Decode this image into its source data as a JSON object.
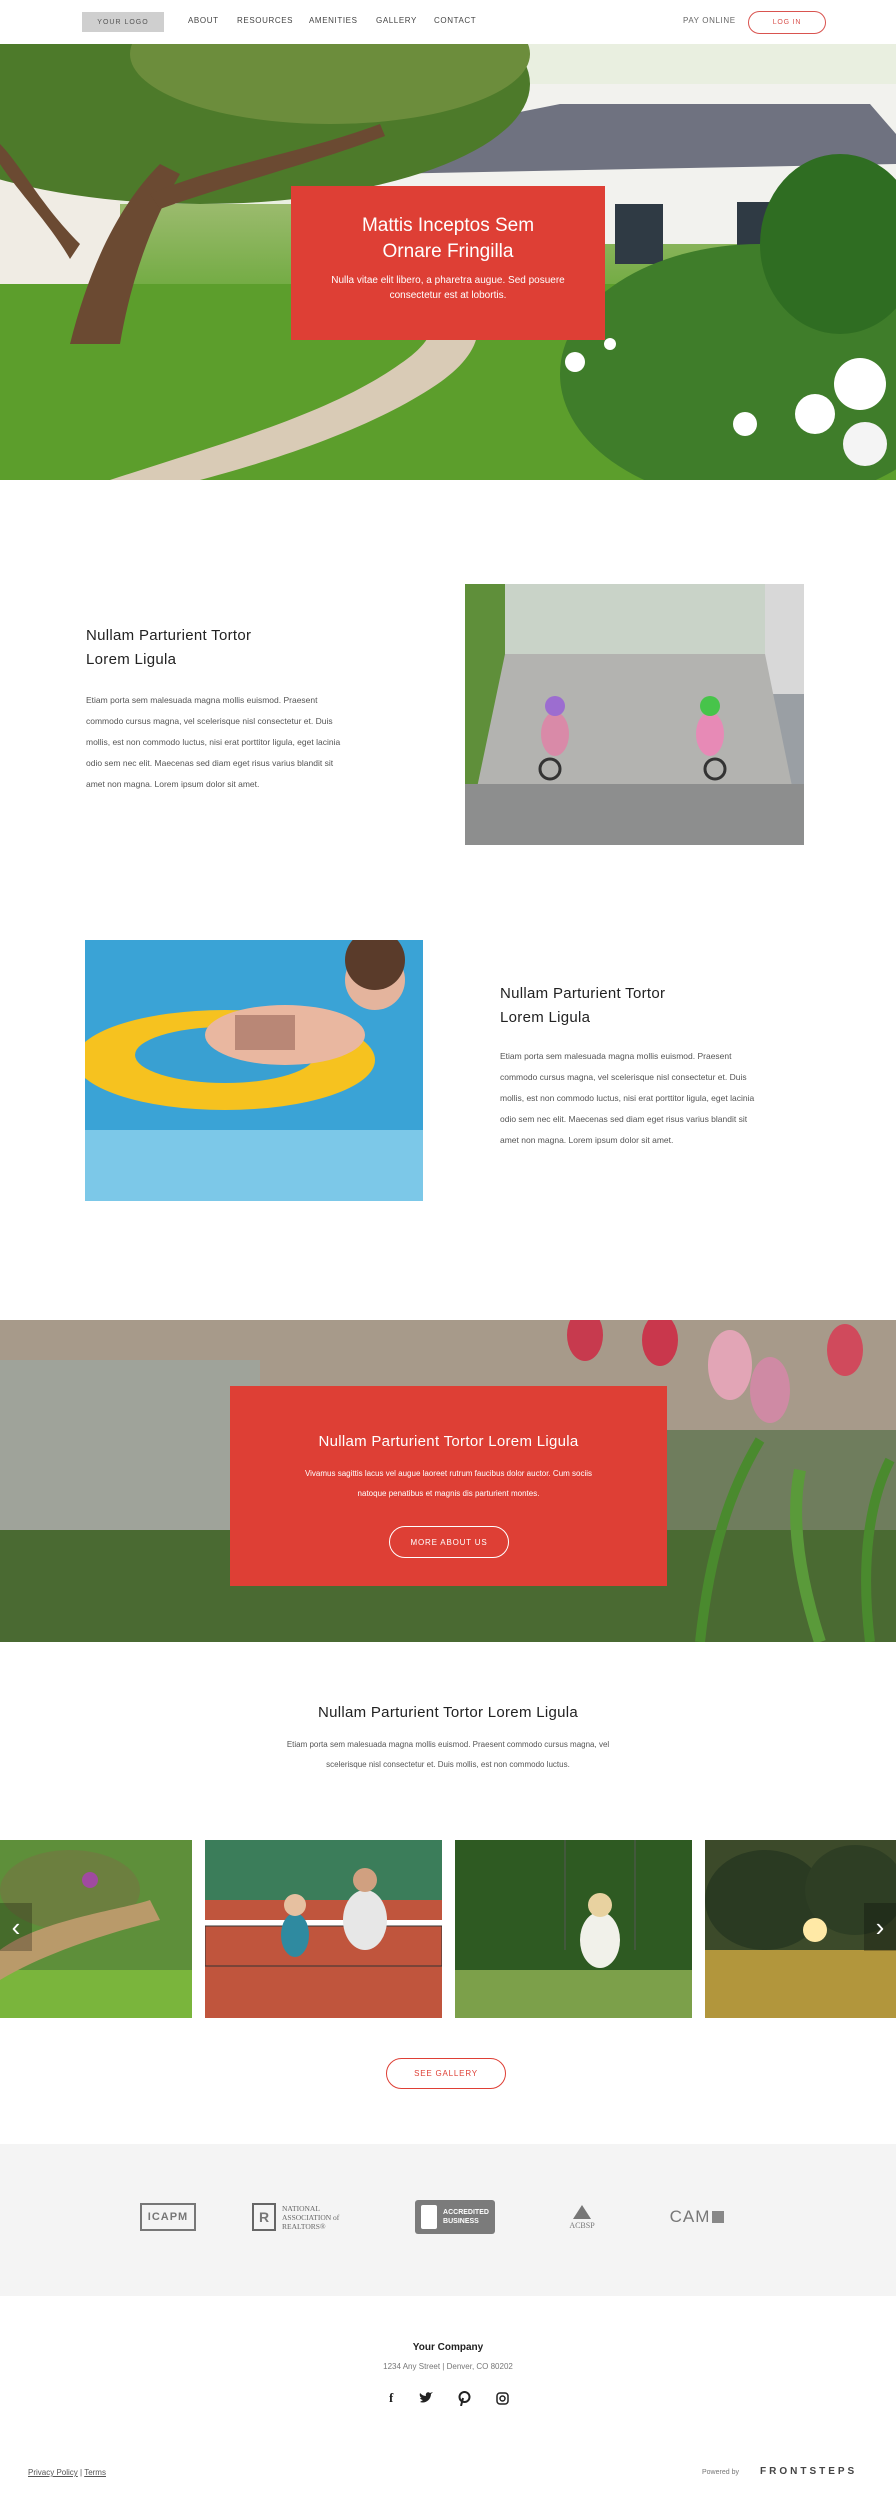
{
  "header": {
    "logo": "YOUR LOGO",
    "nav": [
      "ABOUT",
      "RESOURCES",
      "AMENITIES",
      "GALLERY",
      "CONTACT"
    ],
    "pay_online": "PAY ONLINE",
    "login": "LOG IN"
  },
  "hero": {
    "title_line1": "Mattis Inceptos Sem",
    "title_line2": "Ornare Fringilla",
    "text_line1": "Nulla vitae elit libero, a pharetra augue. Sed posuere",
    "text_line2": "consectetur est at lobortis."
  },
  "feature1": {
    "title_line1": "Nullam Parturient Tortor",
    "title_line2": "Lorem Ligula",
    "lines": [
      "Etiam porta sem malesuada magna mollis euismod. Praesent",
      "commodo cursus magna, vel scelerisque nisl consectetur et. Duis",
      "mollis, est non commodo luctus, nisi erat porttitor ligula, eget lacinia",
      "odio sem nec elit.  Maecenas sed diam eget risus varius blandit sit",
      "amet non magna. Lorem ipsum dolor sit amet."
    ]
  },
  "feature2": {
    "title_line1": "Nullam Parturient Tortor",
    "title_line2": "Lorem Ligula",
    "lines": [
      "Etiam porta sem malesuada magna mollis euismod. Praesent",
      "commodo cursus magna, vel scelerisque nisl consectetur et. Duis",
      "mollis, est non commodo luctus, nisi erat porttitor ligula, eget lacinia",
      "odio sem nec elit.  Maecenas sed diam eget risus varius blandit sit",
      "amet non magna. Lorem ipsum dolor sit amet."
    ]
  },
  "banner": {
    "title": "Nullam Parturient Tortor Lorem Ligula",
    "text_line1": "Vivamus sagittis lacus vel augue laoreet rutrum faucibus dolor auctor. Cum sociis",
    "text_line2": "natoque penatibus et magnis dis parturient montes.",
    "button": "MORE ABOUT US"
  },
  "gallery": {
    "title": "Nullam Parturient Tortor Lorem Ligula",
    "text_line1": "Etiam porta sem malesuada magna mollis euismod. Praesent commodo cursus magna, vel",
    "text_line2": "scelerisque nisl consectetur et. Duis mollis, est non commodo luctus.",
    "button": "SEE GALLERY"
  },
  "partners": {
    "logo1": "ICAPM",
    "logo2_line1": "NATIONAL",
    "logo2_line2": "ASSOCIATION of",
    "logo2_line3": "REALTORS®",
    "logo3_line1": "ACCREDITED",
    "logo3_line2": "BUSINESS",
    "logo4": "ACBSP",
    "logo5": "CAM"
  },
  "footer": {
    "company": "Your Company",
    "address": "1234 Any Street  |  Denver, CO 80202",
    "privacy": "Privacy Policy",
    "separator": "|",
    "terms": "Terms",
    "powered_by": "Powered by",
    "brand": "FRONTSTEPS"
  },
  "colors": {
    "accent": "#de3f35"
  }
}
